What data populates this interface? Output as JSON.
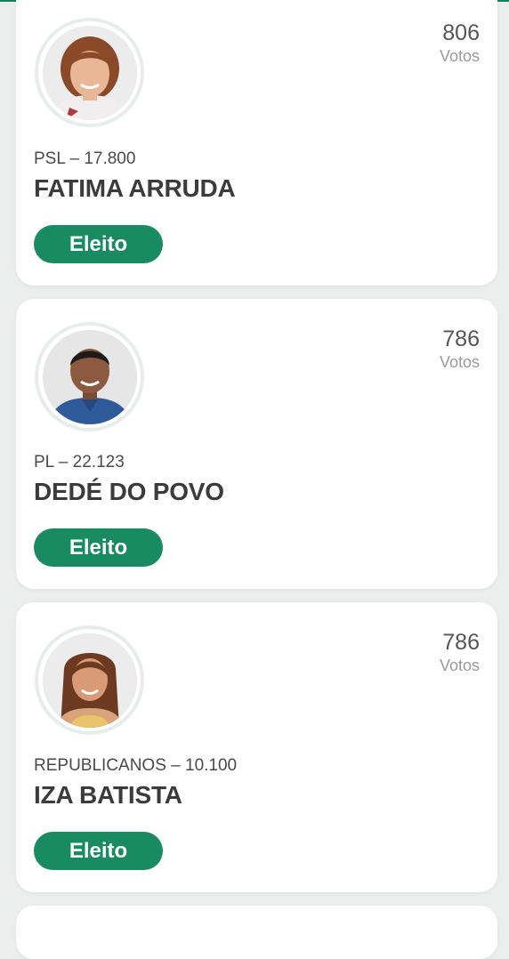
{
  "candidates": [
    {
      "party": "PSL – 17.800",
      "name": "FATIMA ARRUDA",
      "votes": "806",
      "votes_label": "Votos",
      "status": "Eleito",
      "avatar_icon": "candidate-photo"
    },
    {
      "party": "PL – 22.123",
      "name": "DEDÉ DO POVO",
      "votes": "786",
      "votes_label": "Votos",
      "status": "Eleito",
      "avatar_icon": "candidate-photo"
    },
    {
      "party": "REPUBLICANOS – 10.100",
      "name": "IZA BATISTA",
      "votes": "786",
      "votes_label": "Votos",
      "status": "Eleito",
      "avatar_icon": "candidate-photo"
    }
  ],
  "colors": {
    "accent": "#1a8a62",
    "card": "#ffffff",
    "background": "#eceeed"
  }
}
